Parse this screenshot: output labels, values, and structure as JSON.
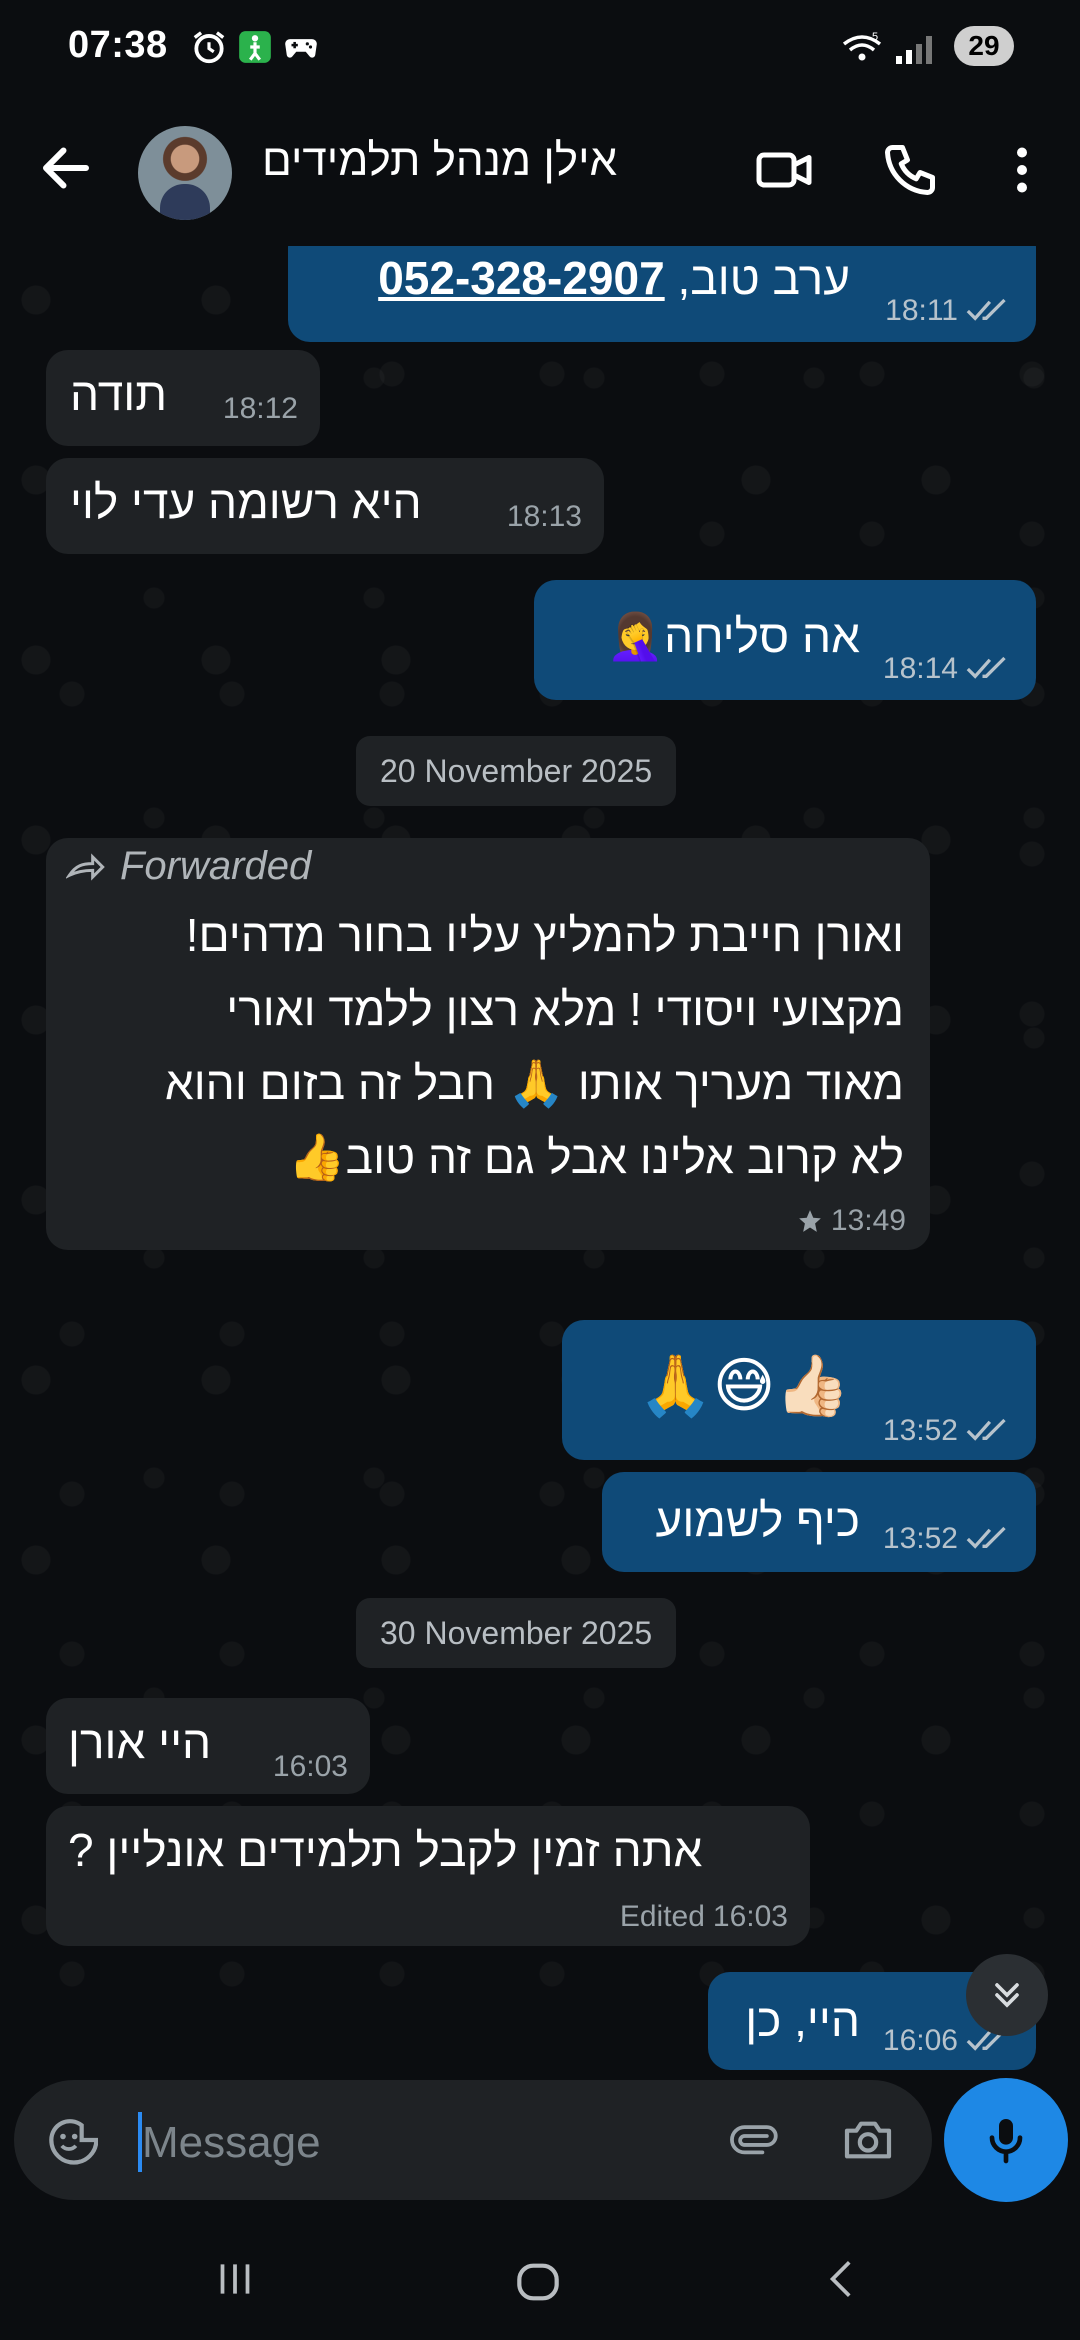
{
  "status_bar": {
    "time": "07:38",
    "battery": "29",
    "network": "5"
  },
  "header": {
    "contact_name": "אילן מנהל תלמידים",
    "icons": [
      "back-arrow-icon",
      "video-call-icon",
      "phone-icon",
      "more-vert-icon"
    ]
  },
  "messages": [
    {
      "dir": "out",
      "phone": "052-328-2907",
      "text": "ערב טוב,",
      "time": "18:11"
    },
    {
      "dir": "in",
      "text": "תודה",
      "time": "18:12"
    },
    {
      "dir": "in",
      "text": "היא רשומה עדי לוי",
      "time": "18:13"
    },
    {
      "dir": "out",
      "text": "אה סליחה",
      "emoji": "🤦‍♀️",
      "time": "18:14"
    },
    {
      "date_chip": "20 November 2025"
    },
    {
      "dir": "in",
      "forwarded_label": "Forwarded",
      "lines": [
        "ואורן חייבת להמליץ עליו בחור מדהים!",
        "מקצועי ויסודי ! מלא רצון ללמד ואורי",
        "מאוד מעריך אותו 🙏 חבל זה בזום והוא",
        "לא קרוב אלינו אבל גם זה טוב👍"
      ],
      "time": "13:49"
    },
    {
      "dir": "out",
      "emoji": "🙏😅👍🏻",
      "time": "13:52"
    },
    {
      "dir": "out",
      "text": "כיף לשמוע",
      "time": "13:52"
    },
    {
      "date_chip": "30 November 2025"
    },
    {
      "dir": "in",
      "text": "היי אורן",
      "time": "16:03"
    },
    {
      "dir": "in",
      "text": "אתה זמין לקבל תלמידים אונליין ?",
      "edited": "Edited",
      "time": "16:03"
    },
    {
      "dir": "out",
      "text": "היי, כן",
      "time": "16:06"
    }
  ],
  "input": {
    "placeholder": "Message"
  }
}
